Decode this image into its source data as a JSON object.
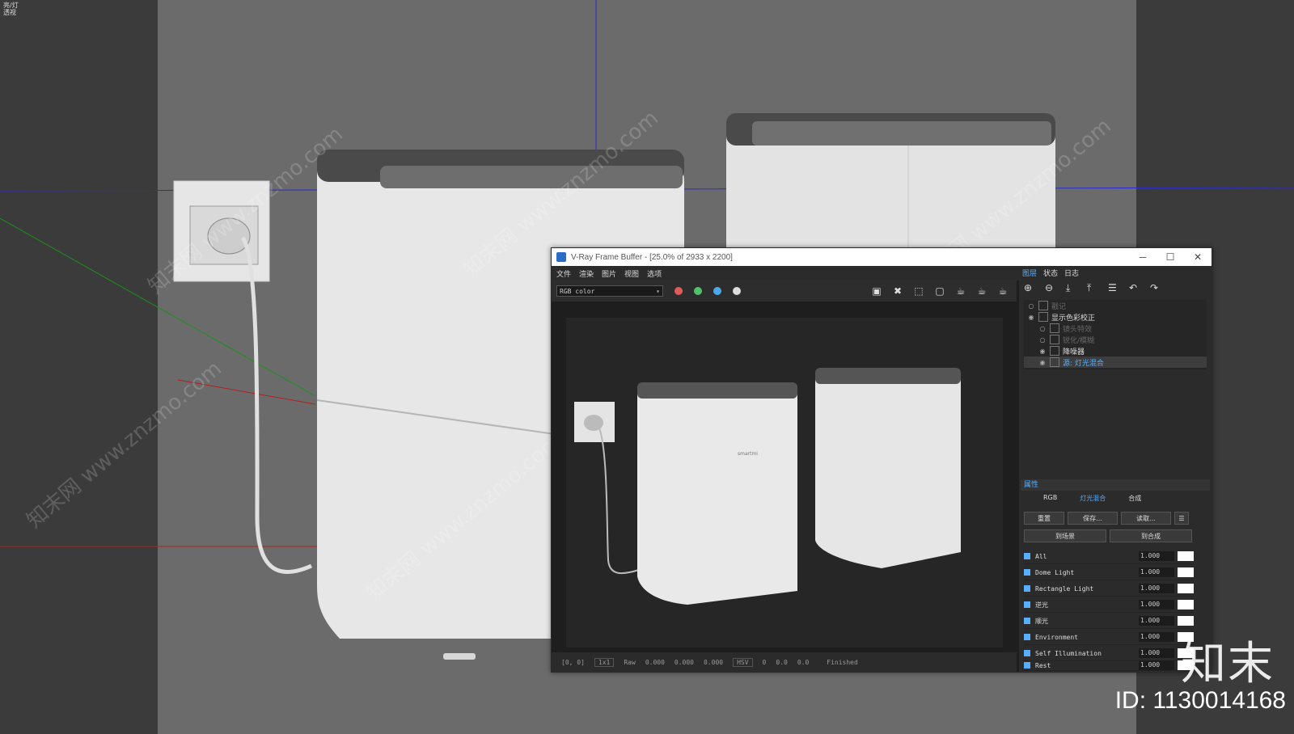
{
  "viewport": {
    "label_line1": "亮/灯",
    "label_line2": "透视"
  },
  "watermark": "知末网 www.znzmo.com",
  "brand_mark": "知末",
  "image_id": "ID: 1130014168",
  "product_text": "smartmi",
  "vfb": {
    "title": "V-Ray Frame Buffer - [25.0% of 2933 x 2200]",
    "minimize": "─",
    "maximize": "☐",
    "close": "✕",
    "menu": [
      "文件",
      "渲染",
      "图片",
      "视图",
      "选项"
    ],
    "channel": "RGB color",
    "dot_colors": [
      "#e05a5a",
      "#4fc36a",
      "#4aa9e8"
    ],
    "status": {
      "coords": "[0, 0]",
      "zoom": "1x1",
      "mode": "Raw",
      "v1": "0.000",
      "v2": "0.000",
      "v3": "0.000",
      "space": "HSV",
      "h": "0",
      "s": "0.0",
      "v": "0.0",
      "state": "Finished"
    },
    "panel_tabs": [
      "图层",
      "状态",
      "日志"
    ],
    "layers": [
      {
        "name": "戳记",
        "dim": true
      },
      {
        "name": "显示色彩校正",
        "dim": false
      },
      {
        "name": "镜头特效",
        "dim": true
      },
      {
        "name": "锐化/模糊",
        "dim": true
      },
      {
        "name": "降噪器",
        "dim": false
      },
      {
        "name": "源: 灯光混合",
        "dim": false,
        "selected": true
      }
    ],
    "attr_title": "属性",
    "radios": [
      "RGB",
      "灯光混合",
      "合成"
    ],
    "buttons": {
      "reset": "重置",
      "save": "保存...",
      "load": "读取...",
      "to_scene": "到场景",
      "to_comp": "到合成"
    },
    "lights": [
      {
        "name": "All",
        "value": "1.000"
      },
      {
        "name": "Dome Light",
        "value": "1.000"
      },
      {
        "name": "Rectangle Light",
        "value": "1.000"
      },
      {
        "name": "逆光",
        "value": "1.000"
      },
      {
        "name": "顺光",
        "value": "1.000"
      },
      {
        "name": "Environment",
        "value": "1.000"
      },
      {
        "name": "Self Illumination",
        "value": "1.000"
      },
      {
        "name": "Rest",
        "value": "1.000"
      }
    ]
  }
}
